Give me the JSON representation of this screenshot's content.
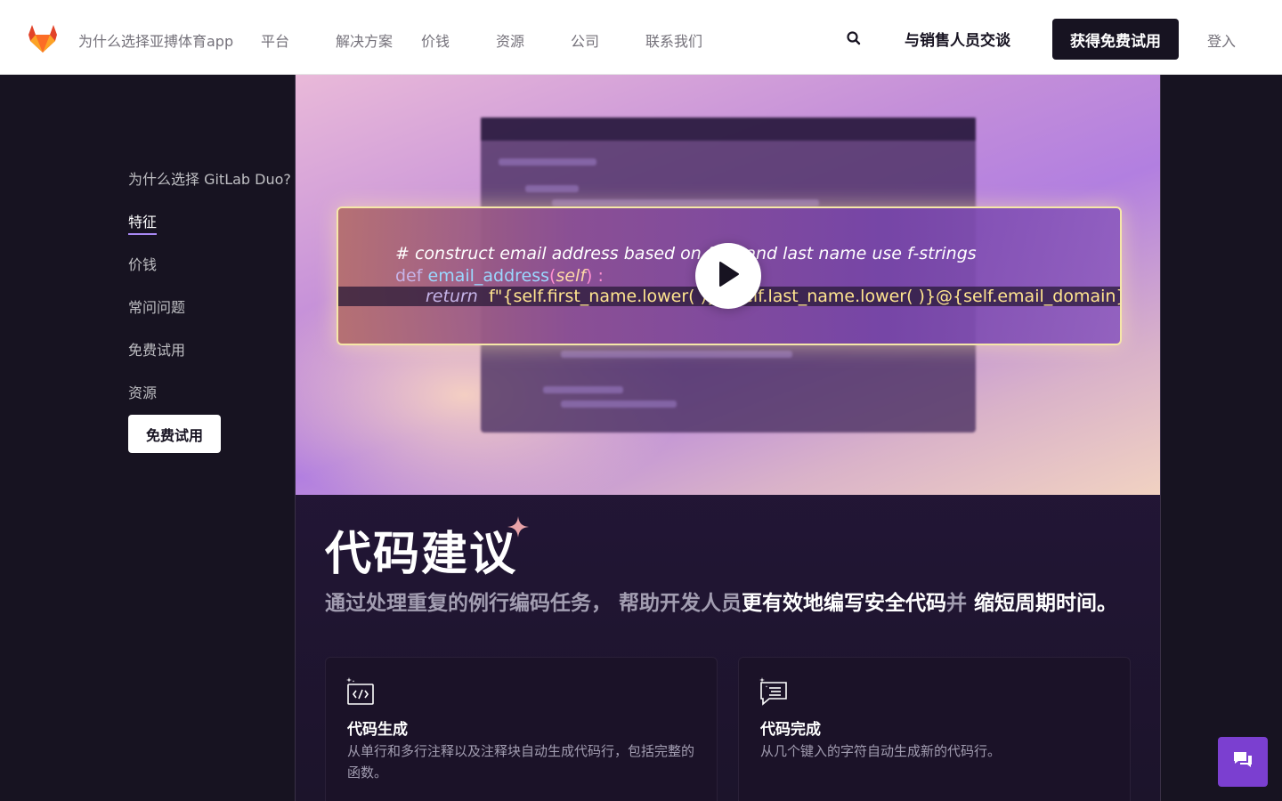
{
  "header": {
    "nav": [
      {
        "label": "为什么选择亚搏体育app"
      },
      {
        "label": "平台"
      },
      {
        "label": "解决方案"
      },
      {
        "label": "价钱"
      },
      {
        "label": "资源"
      },
      {
        "label": "公司"
      },
      {
        "label": "联系我们"
      }
    ],
    "sales_label": "与销售人员交谈",
    "trial_label": "获得免费试用",
    "login_label": "登入",
    "brand_color": "#e24329"
  },
  "sidebar": {
    "items": [
      {
        "label": "为什么选择 GitLab Duo?"
      },
      {
        "label": "特征",
        "active": true
      },
      {
        "label": "价钱"
      },
      {
        "label": "常问问题"
      },
      {
        "label": "免费试用"
      },
      {
        "label": "资源"
      }
    ],
    "button_label": "免费试用"
  },
  "video": {
    "code_comment": "#   construct email address based on first and last name use f-strings",
    "code_def_kw": "def",
    "code_def_name": "email_address",
    "code_def_open": "(",
    "code_def_self": "self",
    "code_def_close": ") :",
    "code_return_kw": "return",
    "code_return_body": "f\"{self.first_name.lower( )}.{self.last_name.lower( )}@{self.email_domain}\"",
    "play_icon": "play-icon"
  },
  "section": {
    "title": "代码建议",
    "subtitle_part1": "通过处理重复的例行编码任务， 帮助开发人员",
    "subtitle_part2": "更有效地编写安全代码",
    "subtitle_part3": "并",
    "subtitle_part4": " 缩短周期时间。",
    "accent_color": "#a989f5"
  },
  "cards": [
    {
      "icon": "code-generation-icon",
      "title": "代码生成",
      "desc": "从单行和多行注释以及注释块自动生成代码行，包括完整的函数。"
    },
    {
      "icon": "code-completion-icon",
      "title": "代码完成",
      "desc": "从几个键入的字符自动生成新的代码行。"
    }
  ],
  "chat": {
    "icon": "chat-icon",
    "color": "#7b3fd0"
  }
}
